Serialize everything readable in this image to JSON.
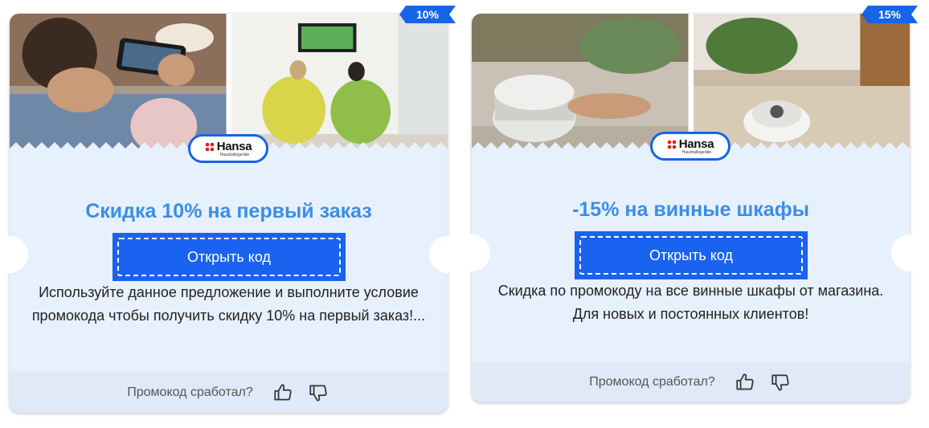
{
  "cards": [
    {
      "badge": "10%",
      "brand": "Hansa",
      "brand_sub": "Haushaltsgeräte",
      "title": "Скидка 10% на первый заказ",
      "button_label": "Открыть код",
      "description": "Используйте данное предложение и выполните условие промокода чтобы получить скидку 10% на первый заказ!...",
      "footer_question": "Промокод сработал?"
    },
    {
      "badge": "15%",
      "brand": "Hansa",
      "brand_sub": "Haushaltsgeräte",
      "title": "-15% на винные шкафы",
      "button_label": "Открыть код",
      "description": "Скидка по промокоду на все винные шкафы от магазина. Для новых и постоянных клиентов!",
      "footer_question": "Промокод сработал?"
    }
  ],
  "colors": {
    "accent": "#1565e6",
    "title": "#3b8ee6",
    "card_bg": "#e7f0fd",
    "button": "#1a62f0"
  },
  "icons": [
    "thumbs-up-icon",
    "thumbs-down-icon",
    "hansa-logo"
  ]
}
